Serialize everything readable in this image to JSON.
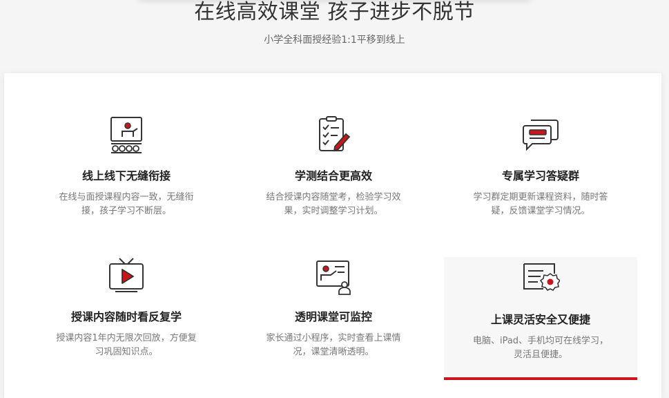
{
  "header": {
    "title": "在线高效课堂 孩子进步不脱节",
    "subtitle": "小学全科面授经验1:1平移到线上"
  },
  "colors": {
    "accent": "#c8161d",
    "icon_stroke": "#333333"
  },
  "features": [
    {
      "icon": "classroom-teacher-icon",
      "title": "线上线下无缝衔接",
      "desc": "在线与面授课程内容一致，无缝衔接，孩子学习不断层。"
    },
    {
      "icon": "checklist-pen-icon",
      "title": "学测结合更高效",
      "desc": "结合授课内容随堂考，检验学习效果，实时调整学习计划。"
    },
    {
      "icon": "chat-bubbles-icon",
      "title": "专属学习答疑群",
      "desc": "学习群定期更新课程资料，随时答疑，反馈课堂学习情况。"
    },
    {
      "icon": "tv-play-icon",
      "title": "授课内容随时看反复学",
      "desc": "授课内容1年内无限次回放，方便复习巩固知识点。"
    },
    {
      "icon": "monitor-teacher-icon",
      "title": "透明课堂可监控",
      "desc": "家长通过小程序，实时查看上课情况，课堂清晰透明。"
    },
    {
      "icon": "certificate-badge-icon",
      "title": "上课灵活安全又便捷",
      "desc": "电脑、iPad、手机均可在线学习，灵活且便捷。"
    }
  ]
}
